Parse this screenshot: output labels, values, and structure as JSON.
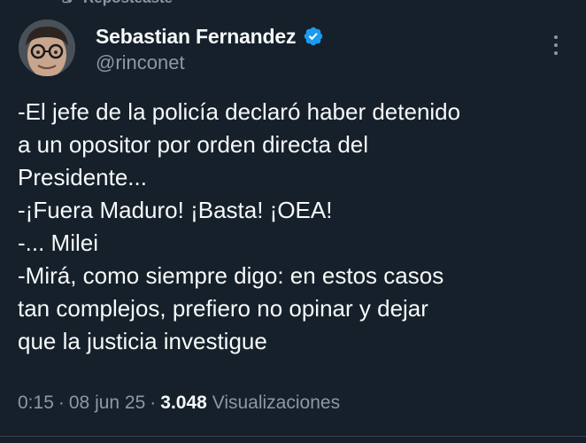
{
  "repost": {
    "label": "Reposteaste",
    "icon": "repost-icon"
  },
  "author": {
    "display_name": "Sebastian Fernandez",
    "handle": "@rinconet",
    "verified": true,
    "verified_color": "#1d9bf0",
    "avatar_icon": "avatar"
  },
  "tweet": {
    "lines": [
      "-El jefe de la policía declaró haber detenido",
      "a un opositor por orden directa del",
      "Presidente...",
      "-¡Fuera Maduro! ¡Basta! ¡OEA!",
      "-... Milei",
      "-Mirá, como siempre digo: en estos casos",
      "tan complejos, prefiero no opinar y dejar",
      "que la justicia investigue"
    ]
  },
  "meta": {
    "time": "0:15",
    "separator": "·",
    "date": "08 jun 25",
    "views_count": "3.048",
    "views_label": "Visualizaciones"
  },
  "colors": {
    "background": "#15202b",
    "text_primary": "#f7f9f9",
    "text_secondary": "#8b98a5",
    "accent": "#1d9bf0"
  }
}
